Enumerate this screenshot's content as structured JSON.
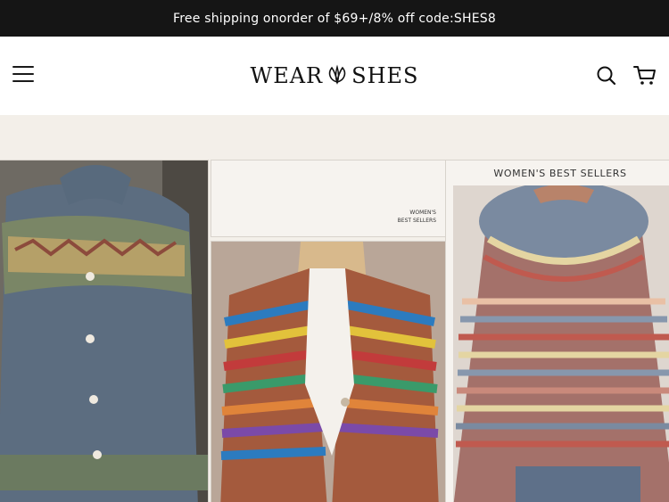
{
  "promo": {
    "text": "Free shipping onorder of $69+/8% off code:SHES8"
  },
  "header": {
    "brand_left": "WEAR",
    "brand_right": "SHES",
    "menu_icon": "hamburger-menu-icon",
    "search_icon": "search-icon",
    "cart_icon": "cart-icon"
  },
  "banner": {
    "panel_small_label_1": "WOMEN'S",
    "panel_small_label_2": "BEST SELLERS",
    "panel_right_title": "WOMEN'S BEST SELLERS"
  },
  "colors": {
    "promo_bg": "#151515",
    "banner_bg": "#f3efe9"
  }
}
